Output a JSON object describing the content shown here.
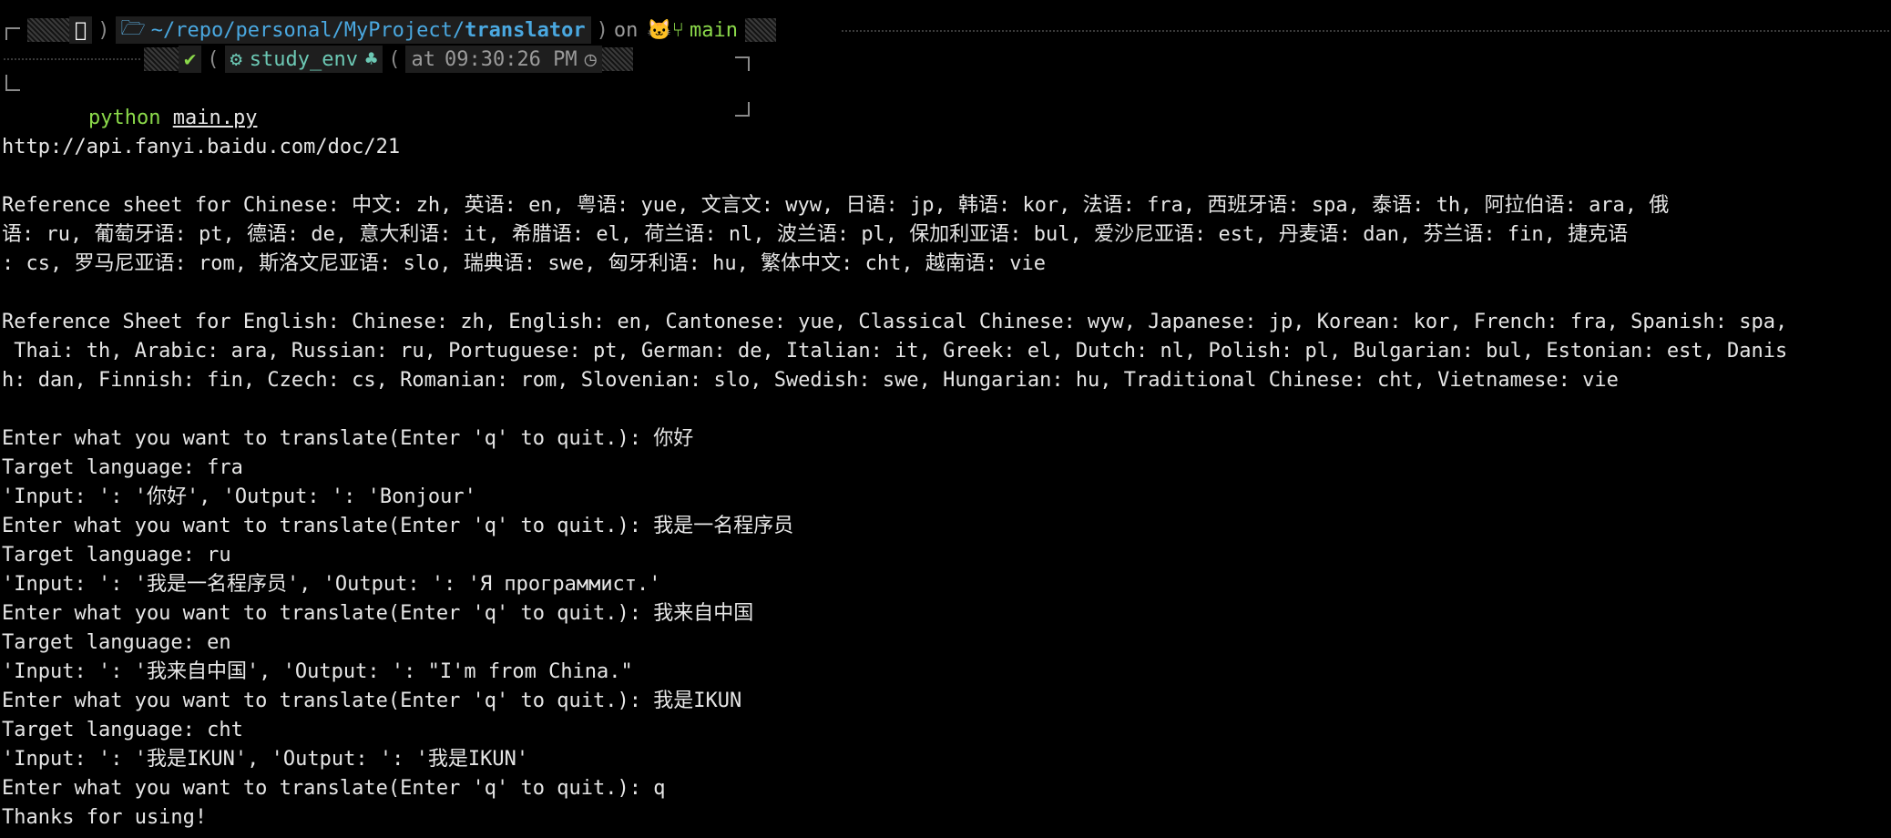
{
  "prompt": {
    "os_icon": "apple-icon",
    "folder_icon": "folder-icon",
    "path_prefix": "~/repo/personal/MyProject/",
    "path_current": "translator",
    "on_text": "on",
    "branch_icons": [
      "github-cat-icon",
      "git-branch-icon"
    ],
    "branch": "main",
    "status_check": "✔",
    "env_icon": "gear-icon",
    "env_name": "study_env",
    "python_icon": "python-icon",
    "at_text": "at",
    "time": "09:30:26 PM",
    "clock_icon": "clock-icon",
    "command_program": "python",
    "command_arg": "main.py"
  },
  "colors": {
    "background": "#000000",
    "text": "#e6e6e6",
    "path": "#4aa8e0",
    "green": "#8bd94a",
    "teal": "#6cc8b4",
    "muted": "#9a9a9a"
  },
  "output": {
    "url": "http://api.fanyi.baidu.com/doc/21",
    "ref_zh": [
      "Reference sheet for Chinese: 中文: zh, 英语: en, 粤语: yue, 文言文: wyw, 日语: jp, 韩语: kor, 法语: fra, 西班牙语: spa, 泰语: th, 阿拉伯语: ara, 俄",
      "语: ru, 葡萄牙语: pt, 德语: de, 意大利语: it, 希腊语: el, 荷兰语: nl, 波兰语: pl, 保加利亚语: bul, 爱沙尼亚语: est, 丹麦语: dan, 芬兰语: fin, 捷克语",
      ": cs, 罗马尼亚语: rom, 斯洛文尼亚语: slo, 瑞典语: swe, 匈牙利语: hu, 繁体中文: cht, 越南语: vie"
    ],
    "ref_en": [
      "Reference Sheet for English: Chinese: zh, English: en, Cantonese: yue, Classical Chinese: wyw, Japanese: jp, Korean: kor, French: fra, Spanish: spa,",
      " Thai: th, Arabic: ara, Russian: ru, Portuguese: pt, German: de, Italian: it, Greek: el, Dutch: nl, Polish: pl, Bulgarian: bul, Estonian: est, Danis",
      "h: dan, Finnish: fin, Czech: cs, Romanian: rom, Slovenian: slo, Swedish: swe, Hungarian: hu, Traditional Chinese: cht, Vietnamese: vie"
    ],
    "session": [
      "Enter what you want to translate(Enter 'q' to quit.): 你好",
      "Target language: fra",
      "'Input: ': '你好', 'Output: ': 'Bonjour'",
      "Enter what you want to translate(Enter 'q' to quit.): 我是一名程序员",
      "Target language: ru",
      "'Input: ': '我是一名程序员', 'Output: ': 'Я программист.'",
      "Enter what you want to translate(Enter 'q' to quit.): 我来自中国",
      "Target language: en",
      "'Input: ': '我来自中国', 'Output: ': \"I'm from China.\"",
      "Enter what you want to translate(Enter 'q' to quit.): 我是IKUN",
      "Target language: cht",
      "'Input: ': '我是IKUN', 'Output: ': '我是IKUN'",
      "Enter what you want to translate(Enter 'q' to quit.): q",
      "Thanks for using!"
    ]
  }
}
